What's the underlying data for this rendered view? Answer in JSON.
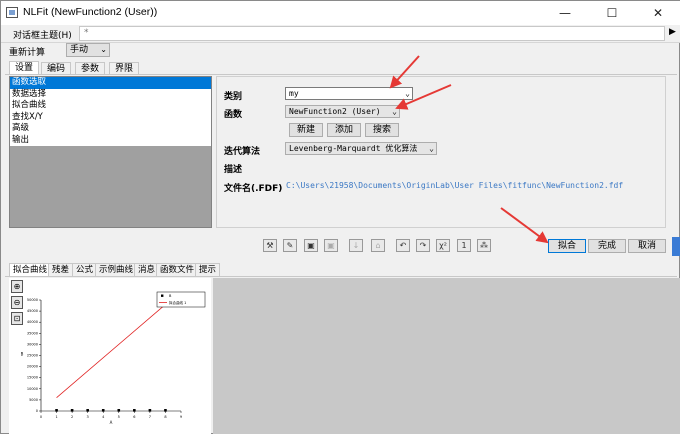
{
  "window": {
    "title": "NLFit (NewFunction2 (User))",
    "minimize": "—",
    "maximize": "☐",
    "close": "✕"
  },
  "theme_bar": {
    "label": "对话框主题(H)",
    "value": "*"
  },
  "recalc": {
    "label": "重新计算",
    "value": "手动"
  },
  "top_tabs": [
    "设置",
    "编码",
    "参数",
    "界限"
  ],
  "tree": {
    "items": [
      "函数选取",
      "数据选择",
      "拟合曲线",
      "查找X/Y",
      "高级",
      "输出"
    ],
    "selected_index": 0
  },
  "settings": {
    "category_label": "类别",
    "category_value": "my",
    "function_label": "函数",
    "function_value": "NewFunction2 (User)",
    "buttons": [
      "新建",
      "添加",
      "搜索"
    ],
    "iteration_label": "迭代算法",
    "iteration_value": "Levenberg-Marquardt 优化算法",
    "description_label": "描述",
    "filename_label": "文件名(.FDF)",
    "filename_value": "C:\\Users\\21958\\Documents\\OriginLab\\User Files\\fitfunc\\NewFunction2.fdf"
  },
  "toolbar": {
    "icons": [
      "init-params-icon",
      "param-settings-icon",
      "save-icon",
      "save-disabled-icon",
      "down-icon",
      "up-icon",
      "undo-icon",
      "redo-icon",
      "chi-square-icon",
      "one-iteration-icon",
      "fit-till-converge-icon"
    ],
    "fit_label": "拟合",
    "done_label": "完成",
    "cancel_label": "取消"
  },
  "bottom_tabs": [
    "拟合曲线",
    "残差",
    "公式",
    "示例曲线",
    "消息",
    "函数文件",
    "提示"
  ],
  "chart_data": {
    "type": "scatter",
    "xlabel": "A",
    "ylabel": "B",
    "xlim": [
      0,
      9
    ],
    "ylim": [
      0,
      50000
    ],
    "x_ticks": [
      "0",
      "1",
      "2",
      "3",
      "4",
      "5",
      "6",
      "7",
      "8",
      "9"
    ],
    "y_ticks": [
      "0",
      "5000",
      "10000",
      "15000",
      "20000",
      "25000",
      "30000",
      "35000",
      "40000",
      "45000",
      "50000"
    ],
    "legend": [
      "B",
      "拟合曲线 1"
    ],
    "series": [
      {
        "name": "B",
        "kind": "points",
        "color": "#000000",
        "x": [
          1,
          2,
          3,
          4,
          5,
          6,
          7,
          8
        ],
        "y": [
          300,
          300,
          300,
          300,
          300,
          300,
          300,
          300
        ]
      },
      {
        "name": "拟合曲线 1",
        "kind": "line",
        "color": "#e02020",
        "x": [
          1,
          8
        ],
        "y": [
          6000,
          48000
        ]
      }
    ]
  },
  "colors": {
    "accent": "#0078d7",
    "path_link": "#3b78c4",
    "fit_line": "#e02020",
    "arrow": "#e53935"
  }
}
